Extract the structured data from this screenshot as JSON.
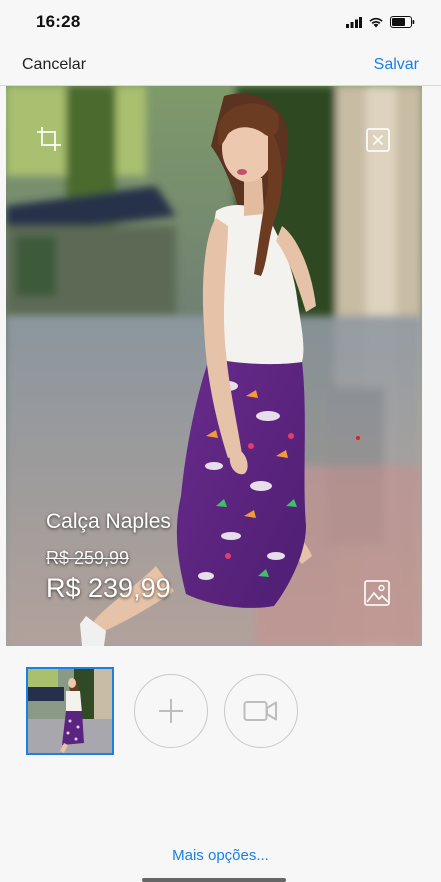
{
  "status_bar": {
    "time": "16:28"
  },
  "nav": {
    "cancel_label": "Cancelar",
    "save_label": "Salvar"
  },
  "product": {
    "name": "Calça Naples",
    "old_price": "R$ 259,99",
    "new_price": "R$ 239,99"
  },
  "icons": {
    "crop": "crop-icon",
    "close": "close-icon",
    "image": "image-icon",
    "add": "plus-icon",
    "video": "video-camera-icon"
  },
  "colors": {
    "accent": "#1a7fe8"
  },
  "footer": {
    "more_options": "Mais opções..."
  }
}
